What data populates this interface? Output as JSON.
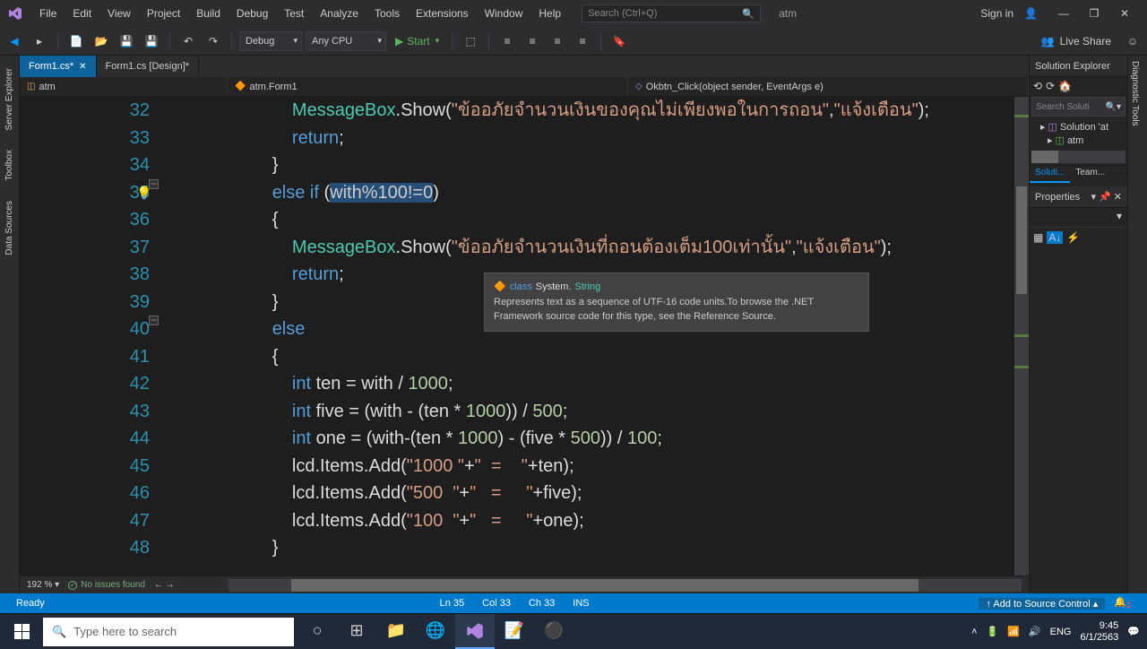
{
  "title": "atm",
  "menus": [
    "File",
    "Edit",
    "View",
    "Project",
    "Build",
    "Debug",
    "Test",
    "Analyze",
    "Tools",
    "Extensions",
    "Window",
    "Help"
  ],
  "search_placeholder": "Search (Ctrl+Q)",
  "signin": "Sign in",
  "config": "Debug",
  "platform": "Any CPU",
  "start": "Start",
  "liveshare": "Live Share",
  "side_tabs": [
    "Server Explorer",
    "Toolbox",
    "Data Sources"
  ],
  "tabs": [
    {
      "label": "Form1.cs*",
      "active": true,
      "closeable": true
    },
    {
      "label": "Form1.cs [Design]*",
      "active": false,
      "closeable": false
    }
  ],
  "breadcrumbs": {
    "namespace": "atm",
    "class": "atm.Form1",
    "method": "Okbtn_Click(object sender, EventArgs e)"
  },
  "lines": [
    {
      "n": 32,
      "indent": 4,
      "marker": true,
      "tokens": [
        {
          "t": "cls",
          "v": "MessageBox"
        },
        {
          "t": "op",
          "v": "."
        },
        {
          "t": "id",
          "v": "Show"
        },
        {
          "t": "op",
          "v": "("
        },
        {
          "t": "str",
          "v": "\"ข้ออภัยจำนวนเงินของคุณไม่เพียงพอในการถอน\""
        },
        {
          "t": "op",
          "v": ","
        },
        {
          "t": "str",
          "v": "\"แจ้งเตือน\""
        },
        {
          "t": "op",
          "v": ");"
        }
      ]
    },
    {
      "n": 33,
      "indent": 4,
      "tokens": [
        {
          "t": "kw",
          "v": "return"
        },
        {
          "t": "op",
          "v": ";"
        }
      ]
    },
    {
      "n": 34,
      "indent": 3,
      "tokens": [
        {
          "t": "op",
          "v": "}"
        }
      ]
    },
    {
      "n": 35,
      "indent": 3,
      "bulb": true,
      "fold": true,
      "tokens": [
        {
          "t": "kw",
          "v": "else if"
        },
        {
          "t": "op",
          "v": " ("
        },
        {
          "t": "sel",
          "v": "with%100!=0"
        },
        {
          "t": "op",
          "v": ")"
        }
      ]
    },
    {
      "n": 36,
      "indent": 3,
      "tokens": [
        {
          "t": "op",
          "v": "{"
        }
      ]
    },
    {
      "n": 37,
      "indent": 4,
      "marker": true,
      "tokens": [
        {
          "t": "cls",
          "v": "MessageBox"
        },
        {
          "t": "op",
          "v": "."
        },
        {
          "t": "id",
          "v": "Show"
        },
        {
          "t": "op",
          "v": "("
        },
        {
          "t": "str",
          "v": "\"ข้ออภัยจำนวนเงินที่ถอนต้องเต็ม100เท่านั้น\""
        },
        {
          "t": "op",
          "v": ","
        },
        {
          "t": "str",
          "v": "\"แจ้งเตือน\""
        },
        {
          "t": "op",
          "v": ");"
        }
      ]
    },
    {
      "n": 38,
      "indent": 4,
      "tokens": [
        {
          "t": "kw",
          "v": "return"
        },
        {
          "t": "op",
          "v": ";"
        }
      ]
    },
    {
      "n": 39,
      "indent": 3,
      "tokens": [
        {
          "t": "op",
          "v": "}"
        }
      ]
    },
    {
      "n": 40,
      "indent": 3,
      "fold": true,
      "tokens": [
        {
          "t": "kw",
          "v": "else"
        }
      ]
    },
    {
      "n": 41,
      "indent": 3,
      "tokens": [
        {
          "t": "op",
          "v": "{"
        }
      ]
    },
    {
      "n": 42,
      "indent": 4,
      "tokens": [
        {
          "t": "kw",
          "v": "int"
        },
        {
          "t": "op",
          "v": " "
        },
        {
          "t": "id",
          "v": "ten = with / "
        },
        {
          "t": "num",
          "v": "1000"
        },
        {
          "t": "op",
          "v": ";"
        }
      ]
    },
    {
      "n": 43,
      "indent": 4,
      "tokens": [
        {
          "t": "kw",
          "v": "int"
        },
        {
          "t": "op",
          "v": " "
        },
        {
          "t": "id",
          "v": "five = (with - (ten * "
        },
        {
          "t": "num",
          "v": "1000"
        },
        {
          "t": "id",
          "v": ")) / "
        },
        {
          "t": "num",
          "v": "500"
        },
        {
          "t": "op",
          "v": ";"
        }
      ]
    },
    {
      "n": 44,
      "indent": 4,
      "tokens": [
        {
          "t": "kw",
          "v": "int"
        },
        {
          "t": "op",
          "v": " "
        },
        {
          "t": "id",
          "v": "one = (with-(ten * "
        },
        {
          "t": "num",
          "v": "1000"
        },
        {
          "t": "id",
          "v": ") - (five * "
        },
        {
          "t": "num",
          "v": "500"
        },
        {
          "t": "id",
          "v": ")) / "
        },
        {
          "t": "num",
          "v": "100"
        },
        {
          "t": "op",
          "v": ";"
        }
      ]
    },
    {
      "n": 45,
      "indent": 4,
      "tokens": [
        {
          "t": "id",
          "v": "lcd.Items.Add("
        },
        {
          "t": "str",
          "v": "\"1000 \""
        },
        {
          "t": "id",
          "v": "+"
        },
        {
          "t": "str",
          "v": "\"  =    \""
        },
        {
          "t": "id",
          "v": "+ten);"
        }
      ]
    },
    {
      "n": 46,
      "indent": 4,
      "tokens": [
        {
          "t": "id",
          "v": "lcd.Items.Add("
        },
        {
          "t": "str",
          "v": "\"500  \""
        },
        {
          "t": "id",
          "v": "+"
        },
        {
          "t": "str",
          "v": "\"   =     \""
        },
        {
          "t": "id",
          "v": "+five);"
        }
      ]
    },
    {
      "n": 47,
      "indent": 4,
      "tokens": [
        {
          "t": "id",
          "v": "lcd.Items.Add("
        },
        {
          "t": "str",
          "v": "\"100  \""
        },
        {
          "t": "id",
          "v": "+"
        },
        {
          "t": "str",
          "v": "\"   =     \""
        },
        {
          "t": "id",
          "v": "+one);"
        }
      ]
    },
    {
      "n": 48,
      "indent": 3,
      "tokens": [
        {
          "t": "op",
          "v": "}"
        }
      ]
    }
  ],
  "tooltip": {
    "prefix": "class",
    "ns": "System.",
    "type": "String",
    "body": "Represents text as a sequence of UTF-16 code units.To browse the .NET Framework source code for this type, see the Reference Source."
  },
  "zoom": "192 %",
  "issues": "No issues found",
  "sol_explorer": {
    "title": "Solution Explorer",
    "search": "Search Soluti",
    "root": "Solution 'at",
    "proj": "atm"
  },
  "sol_tabs": [
    "Soluti...",
    "Team..."
  ],
  "properties": "Properties",
  "far_right": "Diagnostic Tools",
  "status": {
    "ready": "Ready",
    "ln": "Ln 35",
    "col": "Col 33",
    "ch": "Ch 33",
    "ins": "INS",
    "src": "Add to Source Control"
  },
  "taskbar": {
    "search": "Type here to search",
    "time": "9:45",
    "date": "6/1/2563"
  }
}
